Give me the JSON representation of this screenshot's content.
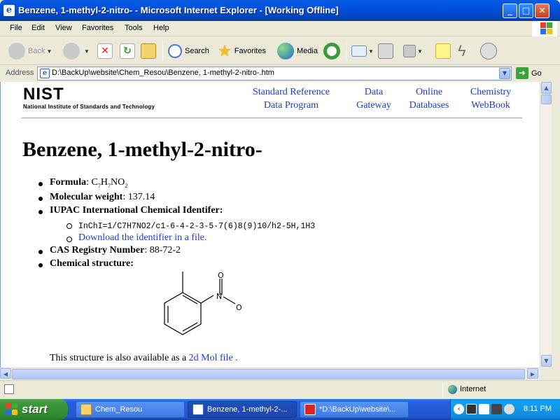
{
  "window": {
    "title": "Benzene, 1-methyl-2-nitro- - Microsoft Internet Explorer - [Working Offline]",
    "controls": {
      "minimize": "_",
      "maximize": "□",
      "close": "✕"
    }
  },
  "menu": [
    "File",
    "Edit",
    "View",
    "Favorites",
    "Tools",
    "Help"
  ],
  "toolbar": {
    "back": "Back",
    "search": "Search",
    "favorites": "Favorites",
    "media": "Media"
  },
  "address": {
    "label": "Address",
    "url": "D:\\BackUp\\website\\Chem_Resou\\Benzene, 1-methyl-2-nitro-.htm",
    "go": "Go"
  },
  "page": {
    "logo": {
      "word": "NIST",
      "subtitle": "National Institute of Standards and Technology"
    },
    "nav": [
      {
        "line1": "Standard Reference",
        "line2": "Data Program"
      },
      {
        "line1": "Data",
        "line2": "Gateway"
      },
      {
        "line1": "Online",
        "line2": "Databases"
      },
      {
        "line1": "Chemistry",
        "line2": "WebBook"
      }
    ],
    "title": "Benzene, 1-methyl-2-nitro-",
    "formula": {
      "label": "Formula",
      "c": "C",
      "c_n": "7",
      "h": "H",
      "h_n": "7",
      "n": "N",
      "o": "O",
      "o_n": "2"
    },
    "mw": {
      "label": "Molecular weight",
      "value": "137.14"
    },
    "iupac": {
      "label": "IUPAC International Chemical Identifer:",
      "inchi": "InChI=1/C7H7NO2/c1-6-4-2-3-5-7(6)8(9)10/h2-5H,1H3",
      "download": "Download the identifier in a file."
    },
    "cas": {
      "label": "CAS Registry Number",
      "value": "88-72-2"
    },
    "structure": {
      "label": "Chemical structure:",
      "atom_n": "N",
      "atom_o_top": "O",
      "atom_o_right": "O"
    },
    "footer": {
      "text": "This structure is also available as a",
      "link": "2d Mol file",
      "end": "."
    }
  },
  "status": {
    "zone": "Internet"
  },
  "taskbar": {
    "start": "start",
    "tasks": [
      "Chem_Resou",
      "Benzene, 1-methyl-2-...",
      "*D:\\BackUp\\website\\..."
    ],
    "clock": "8:11 PM"
  },
  "colors": {
    "link": "#1f3dbc",
    "titlebar": "#0054e3",
    "taskbar": "#245edc",
    "start": "#3a9a3a"
  }
}
